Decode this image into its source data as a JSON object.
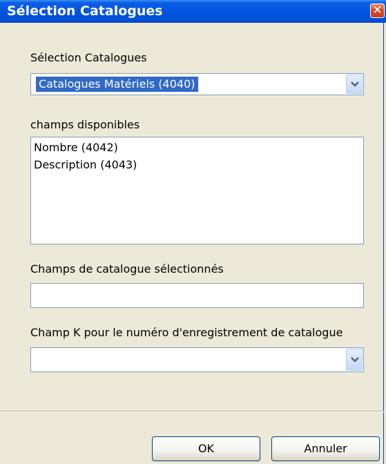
{
  "window": {
    "title": "Sélection Catalogues",
    "close_glyph": "✕"
  },
  "catalogue_select": {
    "label": "Sélection Catalogues",
    "value": "Catalogues Matériels (4040)"
  },
  "available_fields": {
    "label": "champs disponibles",
    "items": [
      "Nombre (4042)",
      "Description (4043)"
    ]
  },
  "selected_fields": {
    "label": "Champs de catalogue sélectionnés",
    "value": ""
  },
  "k_field": {
    "label": "Champ K pour le numéro d'enregistrement de catalogue",
    "value": ""
  },
  "buttons": {
    "ok": "OK",
    "cancel": "Annuler"
  }
}
